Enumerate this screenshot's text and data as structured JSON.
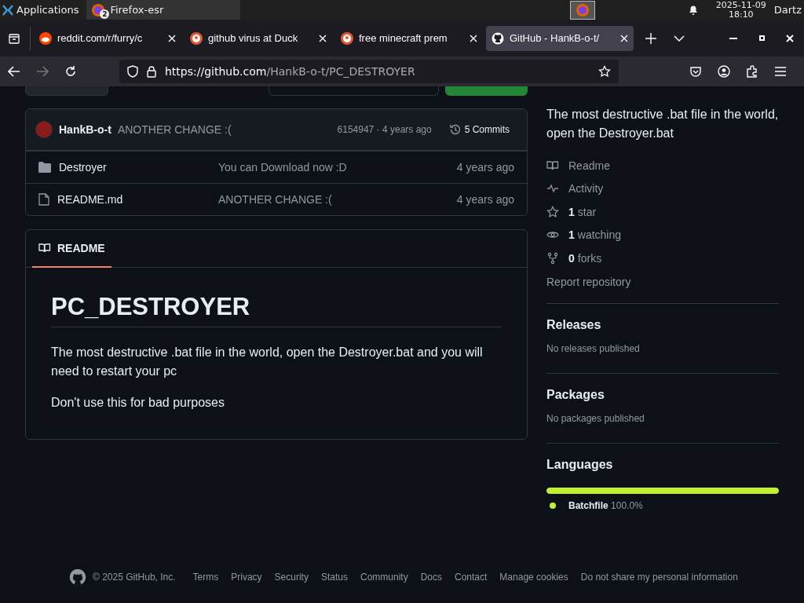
{
  "panel": {
    "apps_label": "Applications",
    "task": {
      "label": "Firefox-esr",
      "badge": "2"
    },
    "date": "2025-11-09",
    "time": "18:10",
    "user": "Dartz"
  },
  "browser": {
    "tabs": [
      {
        "title": "reddit.com/r/furry/c",
        "selected": false
      },
      {
        "title": "github virus at Duck",
        "selected": false
      },
      {
        "title": "free minecraft prem",
        "selected": false
      },
      {
        "title": "GitHub - HankB-o-t/",
        "selected": true
      }
    ],
    "url_host": "https://github.com",
    "url_path": "/HankB-o-t/PC_DESTROYER"
  },
  "commit": {
    "author": "HankB-o-t",
    "message": "ANOTHER CHANGE :(",
    "meta": "6154947 · 4 years ago",
    "commits": "5 Commits"
  },
  "files": [
    {
      "kind": "folder",
      "name": "Destroyer",
      "message": "You can Download now :D",
      "age": "4 years ago"
    },
    {
      "kind": "file",
      "name": "README.md",
      "message": "ANOTHER CHANGE :(",
      "age": "4 years ago"
    }
  ],
  "readme": {
    "tab": "README",
    "title": "PC_DESTROYER",
    "paragraphs": [
      "The most destructive .bat file in the world, open the Destroyer.bat and you will need to restart your pc",
      "Don't use this for bad purposes"
    ]
  },
  "about": {
    "description": "The most destructive .bat file in the world, open the Destroyer.bat",
    "links": [
      {
        "label": "Readme"
      },
      {
        "label": "Activity"
      },
      {
        "count": "1",
        "label": "star"
      },
      {
        "count": "1",
        "label": "watching"
      },
      {
        "count": "0",
        "label": "forks"
      }
    ],
    "report": "Report repository"
  },
  "sections": [
    {
      "title": "Releases",
      "note": "No releases published"
    },
    {
      "title": "Packages",
      "note": "No packages published"
    }
  ],
  "languages": {
    "title": "Languages",
    "items": [
      {
        "name": "Batchfile",
        "percent": "100.0%",
        "level": 1.0,
        "color": "#c1f12e"
      }
    ]
  },
  "footer": {
    "copyright": "© 2025 GitHub, Inc.",
    "links": [
      "Terms",
      "Privacy",
      "Security",
      "Status",
      "Community",
      "Docs",
      "Contact",
      "Manage cookies",
      "Do not share my personal information"
    ]
  }
}
